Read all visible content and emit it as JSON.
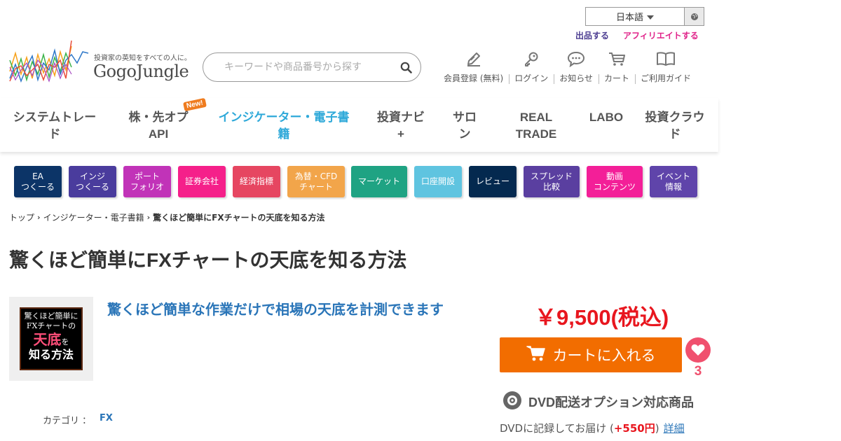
{
  "header": {
    "language": "日本語",
    "sell_link": "出品する",
    "affiliate_link": "アフィリエイトする",
    "logo_tagline": "投資家の英知をすべての人に。",
    "logo_text": "GogoJungle",
    "search_placeholder": "キーワードや商品番号から探す",
    "icons": [
      {
        "icon": "pen-icon",
        "label": "会員登録 (無料)"
      },
      {
        "icon": "key-icon",
        "label": "ログイン"
      },
      {
        "icon": "chat-icon",
        "label": "お知らせ"
      },
      {
        "icon": "cart-icon",
        "label": "カート"
      },
      {
        "icon": "book-icon",
        "label": "ご利用ガイド"
      }
    ]
  },
  "nav": {
    "items": [
      {
        "line1": "システムトレー",
        "line2": "ド"
      },
      {
        "line1": "株・先オプ",
        "line2": "API"
      },
      {
        "line1": "インジケーター・電子書",
        "line2": "籍"
      },
      {
        "line1": "投資ナビ",
        "line2": "+"
      },
      {
        "line1": "サロ",
        "line2": "ン"
      },
      {
        "line1": "REAL",
        "line2": "TRADE"
      },
      {
        "line1": "LABO",
        "line2": ""
      },
      {
        "line1": "投資クラウ",
        "line2": "ド"
      }
    ],
    "new_badge": "New!"
  },
  "categories": [
    {
      "line1": "EA",
      "line2": "つくーる",
      "color": "#0c3467"
    },
    {
      "line1": "インジ",
      "line2": "つくーる",
      "color": "#4a3c9d"
    },
    {
      "line1": "ポート",
      "line2": "フォリオ",
      "color": "#c133b8"
    },
    {
      "line1": "証券会社",
      "line2": "",
      "color": "#f5208a"
    },
    {
      "line1": "経済指標",
      "line2": "",
      "color": "#e64661"
    },
    {
      "line1": "為替・CFD",
      "line2": "チャート",
      "color": "#f2a54a"
    },
    {
      "line1": "マーケット",
      "line2": "",
      "color": "#1fa383"
    },
    {
      "line1": "口座開設",
      "line2": "",
      "color": "#5fc4e0"
    },
    {
      "line1": "レビュー",
      "line2": "",
      "color": "#04294f"
    },
    {
      "line1": "スプレッド",
      "line2": "比較",
      "color": "#5a3fa0"
    },
    {
      "line1": "動画",
      "line2": "コンテンツ",
      "color": "#f31f98"
    },
    {
      "line1": "イベント",
      "line2": "情報",
      "color": "#5f44aa"
    }
  ],
  "breadcrumb": {
    "home": "トップ",
    "category": "インジケーター・電子書籍",
    "current": "驚くほど簡単にFXチャートの天底を知る方法"
  },
  "product": {
    "title": "驚くほど簡単にFXチャートの天底を知る方法",
    "subtitle": "驚くほど簡単な作業だけで相場の天底を計測できます",
    "thumb_line1": "驚くほど簡単に",
    "thumb_line2": "FXチャートの",
    "thumb_line3": "天底",
    "thumb_line3b": "を",
    "thumb_line4": "知る方法",
    "category_label": "カテゴリ ：",
    "category_value": "FX",
    "price": "￥9,500(税込)",
    "cart_button": "カートに入れる",
    "favorite_count": "3",
    "dvd_label": "DVD配送オプション対応商品",
    "dvd_note_prefix": "DVDに記録してお届け (",
    "dvd_note_fee": "+550円",
    "dvd_note_suffix": ")",
    "dvd_detail_link": "詳細"
  }
}
